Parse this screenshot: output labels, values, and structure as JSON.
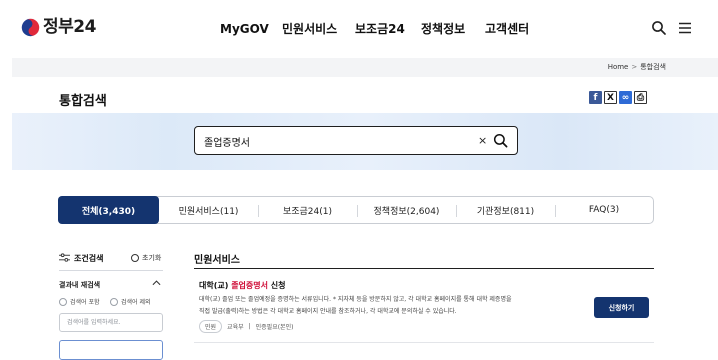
{
  "header": {
    "logo_text": "정부24",
    "nav": [
      "MyGOV",
      "민원서비스",
      "보조금24",
      "정책정보",
      "고객센터"
    ],
    "icons": [
      "search-icon",
      "menu-icon"
    ]
  },
  "breadcrumb": {
    "home": "Home",
    "separator": ">",
    "current": "통합검색"
  },
  "page": {
    "title": "통합검색"
  },
  "share": {
    "buttons": [
      {
        "name": "facebook-share",
        "icon": "facebook-icon",
        "glyph": "f",
        "color": "#3b5998"
      },
      {
        "name": "x-share",
        "icon": "x-icon",
        "glyph": "X",
        "color": "#ffffff"
      },
      {
        "name": "link-share",
        "icon": "link-icon",
        "glyph": "∞",
        "color": "#2e6bd6"
      },
      {
        "name": "print-button",
        "icon": "print-icon",
        "glyph": "⎙",
        "color": "#ffffff"
      }
    ]
  },
  "search": {
    "value": "졸업증명서",
    "clear": "×"
  },
  "tabs": [
    {
      "label": "전체(3,430)",
      "active": true
    },
    {
      "label": "민원서비스(11)",
      "active": false
    },
    {
      "label": "보조금24(1)",
      "active": false
    },
    {
      "label": "정책정보(2,604)",
      "active": false
    },
    {
      "label": "기관정보(811)",
      "active": false
    },
    {
      "label": "FAQ(3)",
      "active": false
    }
  ],
  "filter": {
    "title": "조건검색",
    "reset": "초기화",
    "refine_title": "결과내 재검색",
    "options": [
      "검색어 포함",
      "검색어 제외"
    ],
    "input_placeholder": "검색어를 입력하세요."
  },
  "results": {
    "section_title": "민원서비스",
    "items": [
      {
        "title_prefix": "대학(교) ",
        "title_highlight": "졸업증명서",
        "title_suffix": " 신청",
        "desc_line1": "대학(교) 졸업 또는 졸업예정을 증명하는 서류입니다. * 지자체 등을 방문하지 않고, 각 대학교 홈페이지를 통해 대학 제증명을",
        "desc_line2": "직접 발급(출력)하는 방법은 각 대학교 홈페이지 안내를 참조하거나, 각 대학교에 문의하실 수 있습니다.",
        "badge": "민원",
        "ministry": "교육부",
        "meta_sep": "|",
        "auth": "인증필요(본인)",
        "action": "신청하기"
      }
    ]
  },
  "colors": {
    "primary": "#14346f",
    "highlight": "#d0103a",
    "search_band": "#dce9f8"
  }
}
